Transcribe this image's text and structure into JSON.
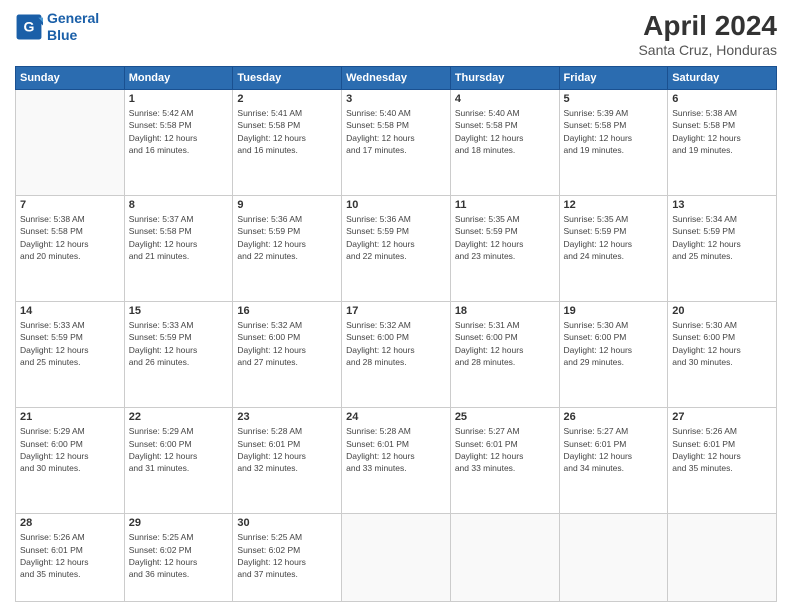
{
  "header": {
    "logo_line1": "General",
    "logo_line2": "Blue",
    "title": "April 2024",
    "subtitle": "Santa Cruz, Honduras"
  },
  "days_of_week": [
    "Sunday",
    "Monday",
    "Tuesday",
    "Wednesday",
    "Thursday",
    "Friday",
    "Saturday"
  ],
  "weeks": [
    [
      {
        "day": "",
        "info": ""
      },
      {
        "day": "1",
        "info": "Sunrise: 5:42 AM\nSunset: 5:58 PM\nDaylight: 12 hours\nand 16 minutes."
      },
      {
        "day": "2",
        "info": "Sunrise: 5:41 AM\nSunset: 5:58 PM\nDaylight: 12 hours\nand 16 minutes."
      },
      {
        "day": "3",
        "info": "Sunrise: 5:40 AM\nSunset: 5:58 PM\nDaylight: 12 hours\nand 17 minutes."
      },
      {
        "day": "4",
        "info": "Sunrise: 5:40 AM\nSunset: 5:58 PM\nDaylight: 12 hours\nand 18 minutes."
      },
      {
        "day": "5",
        "info": "Sunrise: 5:39 AM\nSunset: 5:58 PM\nDaylight: 12 hours\nand 19 minutes."
      },
      {
        "day": "6",
        "info": "Sunrise: 5:38 AM\nSunset: 5:58 PM\nDaylight: 12 hours\nand 19 minutes."
      }
    ],
    [
      {
        "day": "7",
        "info": "Sunrise: 5:38 AM\nSunset: 5:58 PM\nDaylight: 12 hours\nand 20 minutes."
      },
      {
        "day": "8",
        "info": "Sunrise: 5:37 AM\nSunset: 5:58 PM\nDaylight: 12 hours\nand 21 minutes."
      },
      {
        "day": "9",
        "info": "Sunrise: 5:36 AM\nSunset: 5:59 PM\nDaylight: 12 hours\nand 22 minutes."
      },
      {
        "day": "10",
        "info": "Sunrise: 5:36 AM\nSunset: 5:59 PM\nDaylight: 12 hours\nand 22 minutes."
      },
      {
        "day": "11",
        "info": "Sunrise: 5:35 AM\nSunset: 5:59 PM\nDaylight: 12 hours\nand 23 minutes."
      },
      {
        "day": "12",
        "info": "Sunrise: 5:35 AM\nSunset: 5:59 PM\nDaylight: 12 hours\nand 24 minutes."
      },
      {
        "day": "13",
        "info": "Sunrise: 5:34 AM\nSunset: 5:59 PM\nDaylight: 12 hours\nand 25 minutes."
      }
    ],
    [
      {
        "day": "14",
        "info": "Sunrise: 5:33 AM\nSunset: 5:59 PM\nDaylight: 12 hours\nand 25 minutes."
      },
      {
        "day": "15",
        "info": "Sunrise: 5:33 AM\nSunset: 5:59 PM\nDaylight: 12 hours\nand 26 minutes."
      },
      {
        "day": "16",
        "info": "Sunrise: 5:32 AM\nSunset: 6:00 PM\nDaylight: 12 hours\nand 27 minutes."
      },
      {
        "day": "17",
        "info": "Sunrise: 5:32 AM\nSunset: 6:00 PM\nDaylight: 12 hours\nand 28 minutes."
      },
      {
        "day": "18",
        "info": "Sunrise: 5:31 AM\nSunset: 6:00 PM\nDaylight: 12 hours\nand 28 minutes."
      },
      {
        "day": "19",
        "info": "Sunrise: 5:30 AM\nSunset: 6:00 PM\nDaylight: 12 hours\nand 29 minutes."
      },
      {
        "day": "20",
        "info": "Sunrise: 5:30 AM\nSunset: 6:00 PM\nDaylight: 12 hours\nand 30 minutes."
      }
    ],
    [
      {
        "day": "21",
        "info": "Sunrise: 5:29 AM\nSunset: 6:00 PM\nDaylight: 12 hours\nand 30 minutes."
      },
      {
        "day": "22",
        "info": "Sunrise: 5:29 AM\nSunset: 6:00 PM\nDaylight: 12 hours\nand 31 minutes."
      },
      {
        "day": "23",
        "info": "Sunrise: 5:28 AM\nSunset: 6:01 PM\nDaylight: 12 hours\nand 32 minutes."
      },
      {
        "day": "24",
        "info": "Sunrise: 5:28 AM\nSunset: 6:01 PM\nDaylight: 12 hours\nand 33 minutes."
      },
      {
        "day": "25",
        "info": "Sunrise: 5:27 AM\nSunset: 6:01 PM\nDaylight: 12 hours\nand 33 minutes."
      },
      {
        "day": "26",
        "info": "Sunrise: 5:27 AM\nSunset: 6:01 PM\nDaylight: 12 hours\nand 34 minutes."
      },
      {
        "day": "27",
        "info": "Sunrise: 5:26 AM\nSunset: 6:01 PM\nDaylight: 12 hours\nand 35 minutes."
      }
    ],
    [
      {
        "day": "28",
        "info": "Sunrise: 5:26 AM\nSunset: 6:01 PM\nDaylight: 12 hours\nand 35 minutes."
      },
      {
        "day": "29",
        "info": "Sunrise: 5:25 AM\nSunset: 6:02 PM\nDaylight: 12 hours\nand 36 minutes."
      },
      {
        "day": "30",
        "info": "Sunrise: 5:25 AM\nSunset: 6:02 PM\nDaylight: 12 hours\nand 37 minutes."
      },
      {
        "day": "",
        "info": ""
      },
      {
        "day": "",
        "info": ""
      },
      {
        "day": "",
        "info": ""
      },
      {
        "day": "",
        "info": ""
      }
    ]
  ]
}
